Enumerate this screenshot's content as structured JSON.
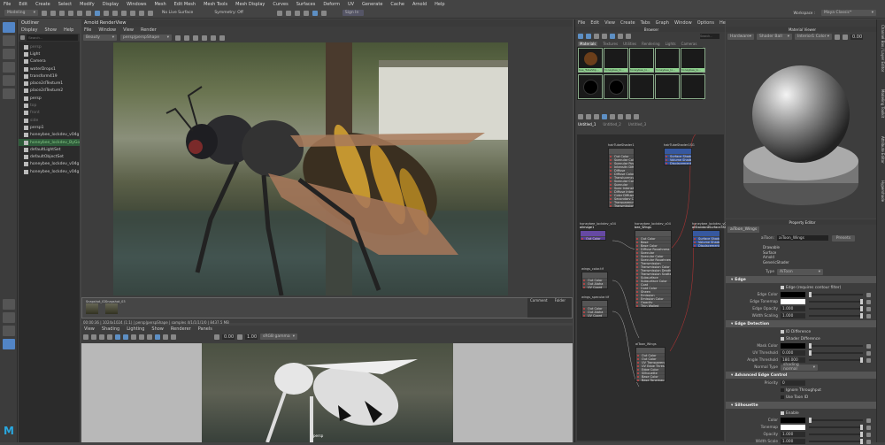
{
  "menubar": [
    "File",
    "Edit",
    "Create",
    "Select",
    "Modify",
    "Display",
    "Windows",
    "Mesh",
    "Edit Mesh",
    "Mesh Tools",
    "Mesh Display",
    "Curves",
    "Surfaces",
    "Deform",
    "UV",
    "Generate",
    "Cache",
    "Arnold",
    "Help"
  ],
  "toolbar": {
    "mode": "Modeling",
    "live_surface": "No Live Surface",
    "symmetry": "Symmetry: Off",
    "sign_in": "Sign In",
    "workspace_label": "Workspace :",
    "workspace": "Maya Classic*"
  },
  "outliner": {
    "title": "Outliner",
    "menu": [
      "Display",
      "Show",
      "Help"
    ],
    "search_placeholder": "Search...",
    "items": [
      {
        "label": "persp",
        "state": "dim"
      },
      {
        "label": "Light",
        "state": ""
      },
      {
        "label": "Camera",
        "state": ""
      },
      {
        "label": "waterDrops1",
        "state": ""
      },
      {
        "label": "transform419",
        "state": ""
      },
      {
        "label": "place2dTexture1",
        "state": ""
      },
      {
        "label": "place2dTexture2",
        "state": ""
      },
      {
        "label": "persp",
        "state": ""
      },
      {
        "label": "top",
        "state": "dim"
      },
      {
        "label": "front",
        "state": "dim"
      },
      {
        "label": "side",
        "state": "dim"
      },
      {
        "label": "persp1",
        "state": ""
      },
      {
        "label": "honeybee_lockdev_v04g",
        "state": ""
      },
      {
        "label": "honeybee_lockdev_ByGoid",
        "state": "green"
      },
      {
        "label": "defaultLightSet",
        "state": ""
      },
      {
        "label": "defaultObjectSet",
        "state": ""
      },
      {
        "label": "honeybee_lockdev_v04g",
        "state": ""
      },
      {
        "label": "honeybee_lockdev_v04g",
        "state": ""
      }
    ]
  },
  "renderview": {
    "title": "Arnold RenderView",
    "menu": [
      "File",
      "Window",
      "View",
      "Render"
    ],
    "aov": "Beauty",
    "camera": "persp|perspShape",
    "snapshots": [
      "Snapshot_02",
      "Snapshot_03"
    ],
    "side_tabs": [
      "Comment",
      "Folder"
    ],
    "status": "00:00:36 | 1024x1024 (1:1) | persp|perspShape | samples 4/1/1/1/1/0 | 8437.5 MB"
  },
  "viewport": {
    "menu": [
      "View",
      "Shading",
      "Lighting",
      "Show",
      "Renderer",
      "Panels"
    ],
    "field1": "0.00",
    "field2": "1.00",
    "colorspace": "sRGB gamma",
    "camera_label": "persp"
  },
  "hypershade": {
    "menu": [
      "File",
      "Edit",
      "View",
      "Create",
      "Tabs",
      "Graph",
      "Window",
      "Options",
      "Help"
    ],
    "browser_title": "Browser",
    "search_placeholder": "Search...",
    "tabs": [
      "Materials",
      "Textures",
      "Utilities",
      "Rendering",
      "Lights",
      "Cameras"
    ],
    "swatches": [
      "bee_TubeShp...",
      "honeybee_lo...",
      "honeybee_lo...",
      "honeybee_lo...",
      "honeybee_lo..."
    ],
    "graph_tabs": [
      "Untitled_1",
      "Untitled_2",
      "Untitled_3"
    ],
    "nodes": {
      "n1": {
        "title": "hairTubeShader1",
        "rows": [
          "Out Color",
          "Specular Color",
          "Specular Power",
          "Intensity Diffuse",
          "Diffuse",
          "Diffuse Coloring",
          "Translucency",
          "Specular Color",
          "Specular",
          "Spec Intensity",
          "Diffuse Intensity",
          "Color Diffuse",
          "Secondary Color",
          "Transparency",
          "Transmission"
        ]
      },
      "n2": {
        "title": "hairTubeShader1SG",
        "rows": [
          "Surface Shader",
          "Volume Shader",
          "Displacement Shader"
        ]
      },
      "n3": {
        "title": "honeybee_lockdev_v04",
        "sub": "aiImage1",
        "rows": [
          "Out Color"
        ]
      },
      "n4": {
        "title": "honeybee_lockdev_v04",
        "sub": "bee_Wings",
        "rows": [
          "Out Color",
          "Base",
          "Base Color",
          "Diffuse Roughness",
          "Specular",
          "Specular Color",
          "Specular Roughness",
          "Transmission",
          "Transmission Color",
          "Transmission Depth",
          "Transmission Scatter",
          "Subsurface",
          "Subsurface Color",
          "Coat",
          "Coat Color",
          "Sheen",
          "Emission",
          "Emission Color",
          "Opacity",
          "Thin Walled"
        ]
      },
      "n5": {
        "title": "honeybee_lockdev_v04",
        "sub": "aiStandardSurface3SG",
        "rows": [
          "Surface Shader",
          "Volume Shader",
          "Displacement Shader"
        ]
      },
      "n6": {
        "title": "wings_color.tif",
        "rows": [
          "Out Color",
          "Out Alpha",
          "UV Coord"
        ]
      },
      "n7": {
        "title": "wings_specular.tif",
        "rows": [
          "Out Color",
          "Out Alpha",
          "UV Coord"
        ]
      },
      "n8": {
        "title": "aiToon_Wings",
        "rows": [
          "Out Color",
          "Out Color",
          "UV Transparency",
          "UV Edge Threshold",
          "Edge Color",
          "Silhouette",
          "Base Color",
          "Base Tonemap"
        ]
      }
    }
  },
  "material_viewer": {
    "title": "Material Viewer",
    "renderer": "Hardware",
    "shape": "Shader Ball",
    "env": "Interior1 Color",
    "exposure": "0.00"
  },
  "property_editor": {
    "title": "Property Editor",
    "tab": "aiToon_Wings",
    "name_label": "aiToon:",
    "name": "aiToon_Wings",
    "presets": "Presets",
    "types": [
      "Drawable",
      "Surface",
      "Arnold",
      "GenericShader"
    ],
    "type_label": "Type",
    "type": "AiToon",
    "sections": {
      "edge": {
        "title": "Edge",
        "check": "Edge (requires contour filter)",
        "rows": [
          {
            "label": "Edge Color",
            "kind": "color",
            "color": "#000000"
          },
          {
            "label": "Edge Tonemap",
            "kind": "color",
            "color": "#ffffff"
          },
          {
            "label": "Edge Opacity",
            "kind": "num",
            "value": "1.000"
          },
          {
            "label": "Width Scaling",
            "kind": "num",
            "value": "1.000"
          }
        ]
      },
      "detection": {
        "title": "Edge Detection",
        "checks": [
          "ID Difference",
          "Shader Difference"
        ],
        "rows": [
          {
            "label": "Mask Color",
            "kind": "color",
            "color": "#000000"
          },
          {
            "label": "UV Threshold",
            "kind": "num",
            "value": "0.000"
          },
          {
            "label": "Angle Threshold",
            "kind": "num",
            "value": "180.000"
          }
        ],
        "normal_label": "Normal Type",
        "normal": "shading normal"
      },
      "advanced": {
        "title": "Advanced Edge Control",
        "priority_label": "Priority",
        "priority": "0",
        "checks": [
          "Ignore Throughput",
          "Use Toon ID"
        ]
      },
      "silhouette": {
        "title": "Silhouette",
        "check": "Enable",
        "rows": [
          {
            "label": "Color",
            "kind": "color",
            "color": "#000000"
          },
          {
            "label": "Tonemap",
            "kind": "color",
            "color": "#ffffff"
          },
          {
            "label": "Opacity",
            "kind": "num",
            "value": "1.000"
          },
          {
            "label": "Width Scale",
            "kind": "num",
            "value": "1.000"
          }
        ]
      }
    }
  },
  "right_tabs": [
    "Channel Box / Layer Editor",
    "Modeling Toolkit",
    "Attribute Editor",
    "Hypershade"
  ],
  "colors": {
    "accent": "#5285c6",
    "panel": "#3d3d3d",
    "node_blue": "#2f4f9a",
    "node_purple": "#5a3f95",
    "swatch_label": "#8fd28f"
  }
}
